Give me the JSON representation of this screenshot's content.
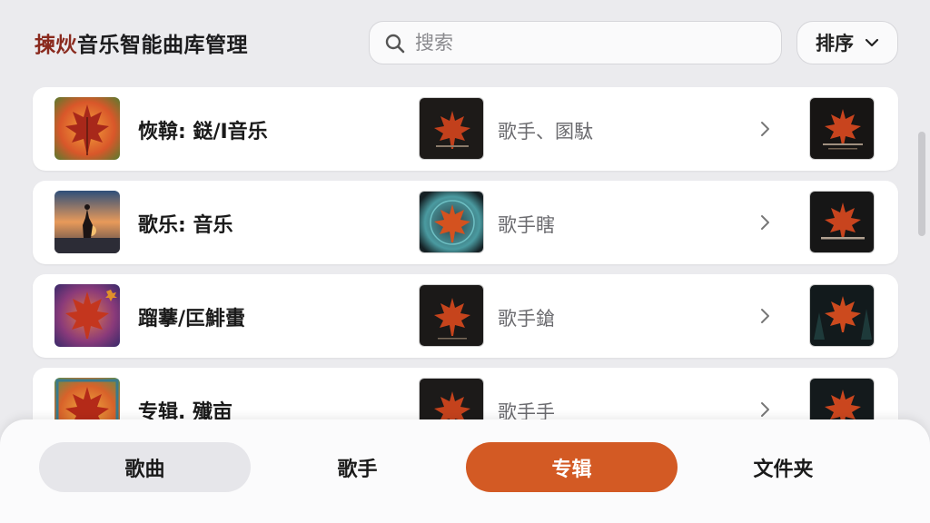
{
  "header": {
    "title_accent": "揀炏",
    "title_rest": "音乐智能曲库管理",
    "search_placeholder": "搜索",
    "sort_label": "排序"
  },
  "rows": [
    {
      "title": "恢鞥: 鎹/I音乐",
      "subtitle": "歌手、圂駄",
      "cover": "maple-orange",
      "mid_cover": "maple-dark",
      "right_cover": "maple-dark-text"
    },
    {
      "title": "歌乐: 音乐",
      "subtitle": "歌手瞎",
      "cover": "sunset-figure",
      "mid_cover": "maple-teal-ring",
      "right_cover": "maple-dark-text"
    },
    {
      "title": "蹓藆/匞鯡蟗",
      "subtitle": "歌手鎗",
      "cover": "maple-purple",
      "mid_cover": "maple-dark",
      "right_cover": "maple-dark-forest"
    },
    {
      "title": "专辑. 殱亩",
      "subtitle": "歌手手",
      "cover": "maple-orange-frame",
      "mid_cover": "maple-dark",
      "right_cover": "maple-dark-forest"
    }
  ],
  "tabs": [
    {
      "label": "歌曲",
      "state": "highlighted"
    },
    {
      "label": "歌手",
      "state": "normal"
    },
    {
      "label": "专辑",
      "state": "active"
    },
    {
      "label": "文件夹",
      "state": "normal"
    }
  ],
  "colors": {
    "accent": "#d35a24",
    "title_accent": "#8a2a1e",
    "background": "#ebebee"
  }
}
